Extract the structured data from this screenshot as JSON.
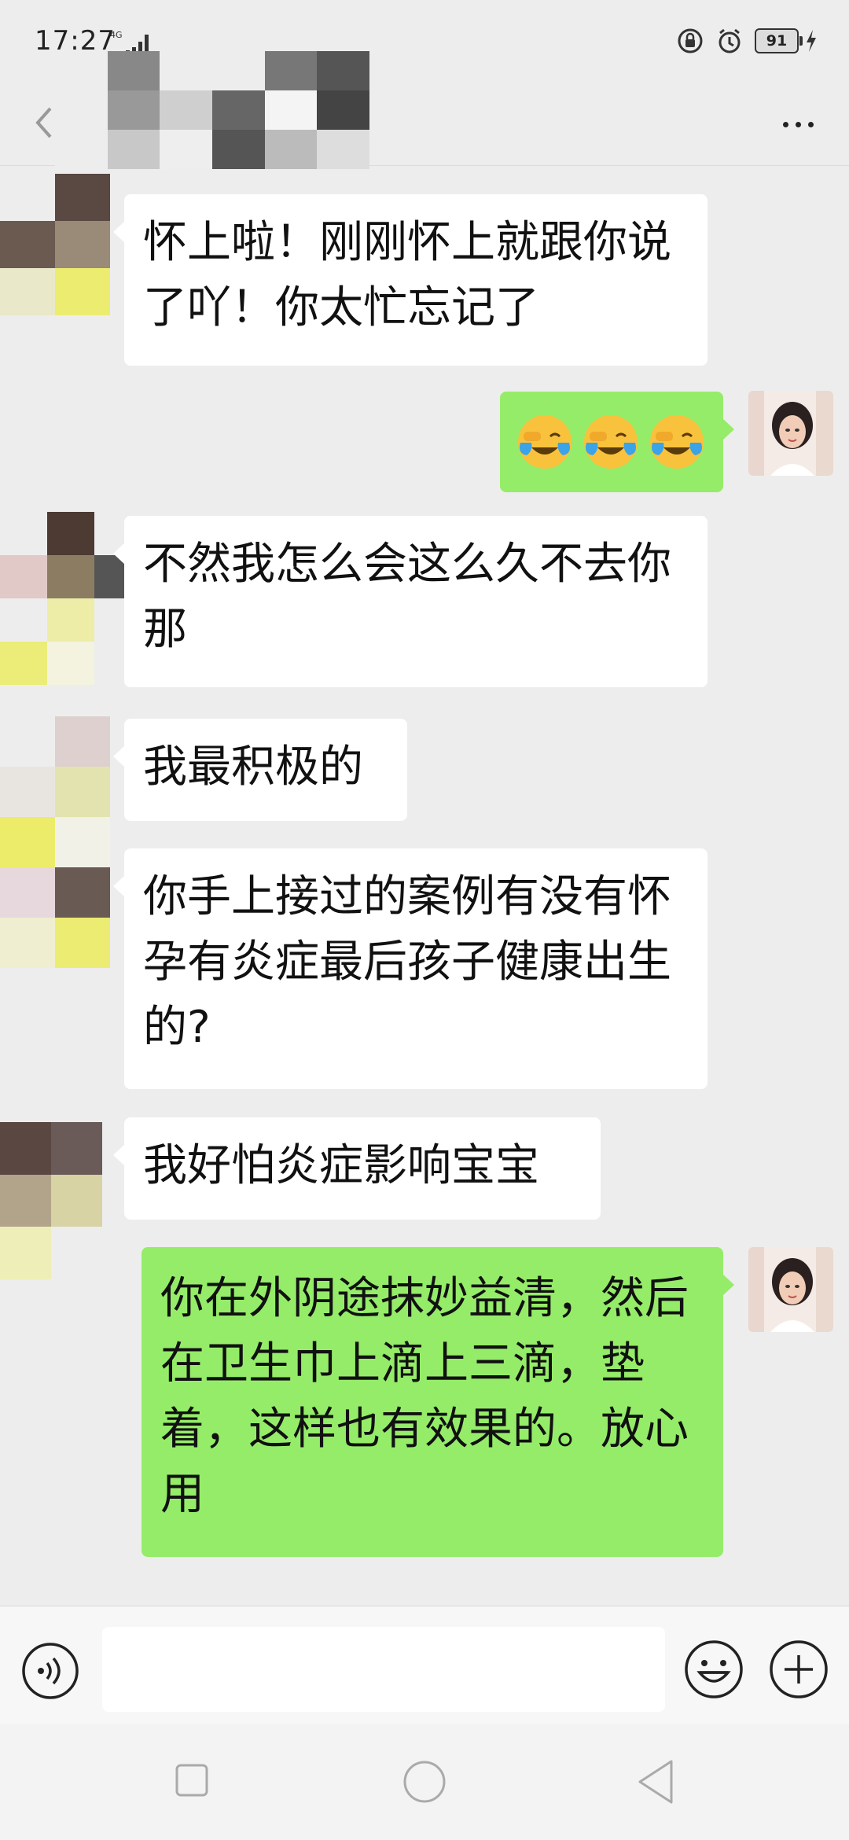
{
  "status_bar": {
    "time": "17:27",
    "network": "4G",
    "battery": "91"
  },
  "title_bar": {
    "contact_name": ""
  },
  "messages": [
    {
      "side": "in",
      "text": "怀上啦！刚刚怀上就跟你说了吖！你太忙忘记了"
    },
    {
      "side": "out",
      "emojis": [
        "crying-laughing-emoji",
        "crying-laughing-emoji",
        "crying-laughing-emoji"
      ]
    },
    {
      "side": "in",
      "text": "不然我怎么会这么久不去你那"
    },
    {
      "side": "in",
      "text": "我最积极的"
    },
    {
      "side": "in",
      "text": "你手上接过的案例有没有怀孕有炎症最后孩子健康出生的?"
    },
    {
      "side": "in",
      "text": "我好怕炎症影响宝宝"
    },
    {
      "side": "out",
      "text": "你在外阴途抹妙益清，然后在卫生巾上滴上三滴，垫着，这样也有效果的。放心用"
    }
  ],
  "input_bar": {
    "value": ""
  },
  "colors": {
    "background": "#ededed",
    "outgoing_bubble": "#95ec69",
    "incoming_bubble": "#ffffff"
  }
}
